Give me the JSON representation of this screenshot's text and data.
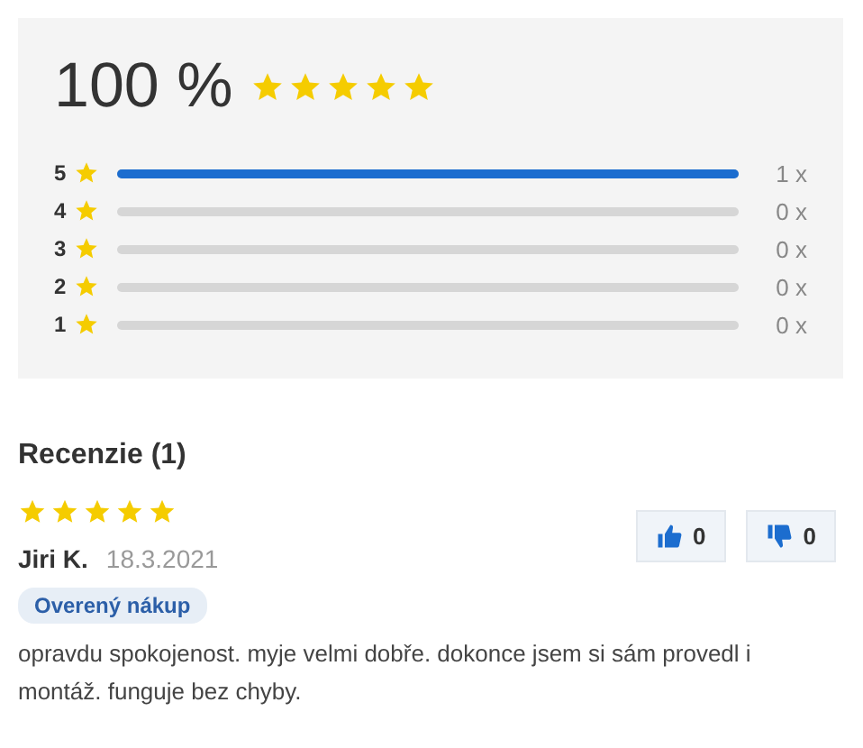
{
  "summary": {
    "percent": "100 %",
    "stars": 5,
    "distribution": [
      {
        "label": "5",
        "level": 1,
        "count": "1 x"
      },
      {
        "label": "4",
        "level": 0,
        "count": "0 x"
      },
      {
        "label": "3",
        "level": 0,
        "count": "0 x"
      },
      {
        "label": "2",
        "level": 0,
        "count": "0 x"
      },
      {
        "label": "1",
        "level": 0,
        "count": "0 x"
      }
    ]
  },
  "reviews_heading": "Recenzie (1)",
  "reviews": [
    {
      "stars": 5,
      "author": "Jiri K.",
      "date": "18.3.2021",
      "badge": "Overený nákup",
      "likes": "0",
      "dislikes": "0",
      "text": "opravdu spokojenost. myje velmi dobře. dokonce jsem si sám provedl i montáž. funguje bez chyby."
    }
  ]
}
